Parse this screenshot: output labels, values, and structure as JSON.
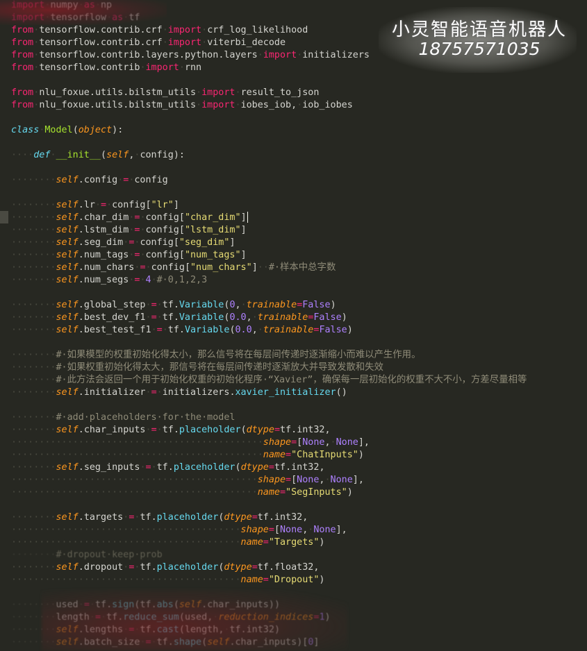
{
  "watermark": {
    "title": "小灵智能语音机器人",
    "phone": "18757571035"
  },
  "code": {
    "lines": [
      {
        "idx": 0,
        "text": "import·numpy·as·np"
      },
      {
        "idx": 1,
        "text": "import·tensorflow·as·tf"
      },
      {
        "idx": 2,
        "text": "from·tensorflow.contrib.crf·import·crf_log_likelihood"
      },
      {
        "idx": 3,
        "text": "from·tensorflow.contrib.crf·import·viterbi_decode"
      },
      {
        "idx": 4,
        "text": "from·tensorflow.contrib.layers.python.layers·import·initializers"
      },
      {
        "idx": 5,
        "text": "from·tensorflow.contrib·import·rnn"
      },
      {
        "idx": 6,
        "text": ""
      },
      {
        "idx": 7,
        "text": "from·nlu_foxue.utils.bilstm_utils·import·result_to_json"
      },
      {
        "idx": 8,
        "text": "from·nlu_foxue.utils.bilstm_utils·import·iobes_iob,·iob_iobes"
      },
      {
        "idx": 9,
        "text": ""
      },
      {
        "idx": 10,
        "text": "class·Model(object):"
      },
      {
        "idx": 11,
        "text": ""
      },
      {
        "idx": 12,
        "text": "····def·__init__(self,·config):"
      },
      {
        "idx": 13,
        "text": ""
      },
      {
        "idx": 14,
        "text": "········self.config·=·config"
      },
      {
        "idx": 15,
        "text": ""
      },
      {
        "idx": 16,
        "text": "········self.lr·=·config[\"lr\"]"
      },
      {
        "idx": 17,
        "text": "········self.char_dim·=·config[\"char_dim\"]"
      },
      {
        "idx": 18,
        "text": "········self.lstm_dim·=·config[\"lstm_dim\"]"
      },
      {
        "idx": 19,
        "text": "········self.seg_dim·=·config[\"seg_dim\"]"
      },
      {
        "idx": 20,
        "text": "········self.num_tags·=·config[\"num_tags\"]"
      },
      {
        "idx": 21,
        "text": "········self.num_chars·=·config[\"num_chars\"]··#·样本中总字数"
      },
      {
        "idx": 22,
        "text": "········self.num_segs·=·4·#·0,1,2,3"
      },
      {
        "idx": 23,
        "text": ""
      },
      {
        "idx": 24,
        "text": "········self.global_step·=·tf.Variable(0,·trainable=False)"
      },
      {
        "idx": 25,
        "text": "········self.best_dev_f1·=·tf.Variable(0.0,·trainable=False)"
      },
      {
        "idx": 26,
        "text": "········self.best_test_f1·=·tf.Variable(0.0,·trainable=False)"
      },
      {
        "idx": 27,
        "text": ""
      },
      {
        "idx": 28,
        "text": "········#·如果模型的权重初始化得太小，那么信号将在每层间传递时逐渐缩小而难以产生作用。"
      },
      {
        "idx": 29,
        "text": "········#·如果权重初始化得太大，那信号将在每层间传递时逐渐放大并导致发散和失效"
      },
      {
        "idx": 30,
        "text": "········#·此方法会返回一个用于初始化权重的初始化程序·“Xavier”，确保每一层初始化的权重不大不小，方差尽量相等"
      },
      {
        "idx": 31,
        "text": "········self.initializer·=·initializers.xavier_initializer()"
      },
      {
        "idx": 32,
        "text": ""
      },
      {
        "idx": 33,
        "text": "········#·add·placeholders·for·the·model"
      },
      {
        "idx": 34,
        "text": "········self.char_inputs·=·tf.placeholder(dtype=tf.int32,"
      },
      {
        "idx": 35,
        "text": "·············································shape=[None,·None],"
      },
      {
        "idx": 36,
        "text": "·············································name=\"ChatInputs\")"
      },
      {
        "idx": 37,
        "text": "········self.seg_inputs·=·tf.placeholder(dtype=tf.int32,"
      },
      {
        "idx": 38,
        "text": "············································shape=[None,·None],"
      },
      {
        "idx": 39,
        "text": "············································name=\"SegInputs\")"
      },
      {
        "idx": 40,
        "text": ""
      },
      {
        "idx": 41,
        "text": "········self.targets·=·tf.placeholder(dtype=tf.int32,"
      },
      {
        "idx": 42,
        "text": "·········································shape=[None,·None],"
      },
      {
        "idx": 43,
        "text": "·········································name=\"Targets\")"
      },
      {
        "idx": 44,
        "text": "········#·dropout·keep·prob"
      },
      {
        "idx": 45,
        "text": "········self.dropout·=·tf.placeholder(dtype=tf.float32,"
      },
      {
        "idx": 46,
        "text": "·········································name=\"Dropout\")"
      },
      {
        "idx": 47,
        "text": ""
      },
      {
        "idx": 48,
        "text": "········used·=·tf.sign(tf.abs(self.char_inputs))"
      },
      {
        "idx": 49,
        "text": "········length·=·tf.reduce_sum(used,·reduction_indices=1)"
      },
      {
        "idx": 50,
        "text": "········self.lengths·=·tf.cast(length,·tf.int32)"
      },
      {
        "idx": 51,
        "text": "········self.batch_size·=·tf.shape(self.char_inputs)[0]"
      }
    ]
  },
  "colors": {
    "background": "#272822",
    "keyword": "#f92672",
    "class_name": "#a6e22e",
    "builtin": "#66d9ef",
    "self": "#fd971f",
    "string": "#e6db74",
    "number": "#ae81ff",
    "comment": "#8f8b78"
  }
}
